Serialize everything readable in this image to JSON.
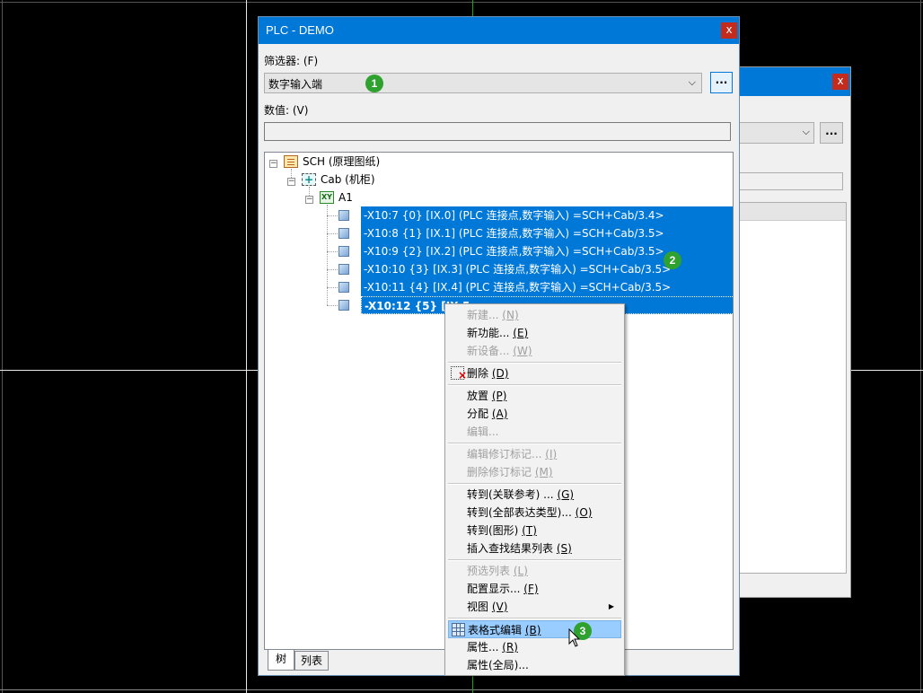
{
  "window": {
    "title": "PLC - DEMO",
    "close_label": "x"
  },
  "background_window": {
    "close_label": "x",
    "dots_label": "..."
  },
  "filter": {
    "label": "筛选器: (F)",
    "value": "数字输入端",
    "more_label": "..."
  },
  "value_field": {
    "label": "数值: (V)",
    "value": ""
  },
  "tree": {
    "root": "SCH (原理图纸)",
    "cabinet": "Cab (机柜)",
    "location": "A1",
    "location_icon_text": "XY",
    "items": [
      "-X10:7 {0} [IX.0] (PLC 连接点,数字输入) =SCH+Cab/3.4>",
      "-X10:8 {1} [IX.1] (PLC 连接点,数字输入) =SCH+Cab/3.5>",
      "-X10:9 {2} [IX.2] (PLC 连接点,数字输入) =SCH+Cab/3.5>",
      "-X10:10 {3} [IX.3] (PLC 连接点,数字输入) =SCH+Cab/3.5>",
      "-X10:11 {4} [IX.4] (PLC 连接点,数字输入) =SCH+Cab/3.5>",
      "-X10:12 {5} [IX.5"
    ]
  },
  "tabs": [
    "树",
    "列表"
  ],
  "badges": [
    "1",
    "2",
    "3"
  ],
  "context_menu": {
    "items": [
      {
        "label": "新建...",
        "key": "(N)",
        "disabled": true
      },
      {
        "label": "新功能...",
        "key": "(E)",
        "disabled": false
      },
      {
        "label": "新设备...",
        "key": "(W)",
        "disabled": true
      },
      {
        "label": "删除",
        "key": "(D)",
        "disabled": false
      },
      {
        "label": "放置",
        "key": "(P)",
        "disabled": false
      },
      {
        "label": "分配",
        "key": "(A)",
        "disabled": false
      },
      {
        "label": "编辑...",
        "key": "",
        "disabled": true
      },
      {
        "label": "编辑修订标记...",
        "key": "(I)",
        "disabled": true
      },
      {
        "label": "删除修订标记",
        "key": "(M)",
        "disabled": true
      },
      {
        "label": "转到(关联参考) ...",
        "key": "(G)",
        "disabled": false
      },
      {
        "label": "转到(全部表达类型)...",
        "key": "(O)",
        "disabled": false
      },
      {
        "label": "转到(图形)",
        "key": "(T)",
        "disabled": false
      },
      {
        "label": "插入查找结果列表",
        "key": "(S)",
        "disabled": false
      },
      {
        "label": "预选列表",
        "key": "(L)",
        "disabled": true
      },
      {
        "label": "配置显示...",
        "key": "(F)",
        "disabled": false
      },
      {
        "label": "视图",
        "key": "(V)",
        "disabled": false
      },
      {
        "label": "表格式编辑",
        "key": "(B)",
        "disabled": false
      },
      {
        "label": "属性...",
        "key": "(R)",
        "disabled": false
      },
      {
        "label": "属性(全局)...",
        "key": "",
        "disabled": false
      }
    ]
  }
}
